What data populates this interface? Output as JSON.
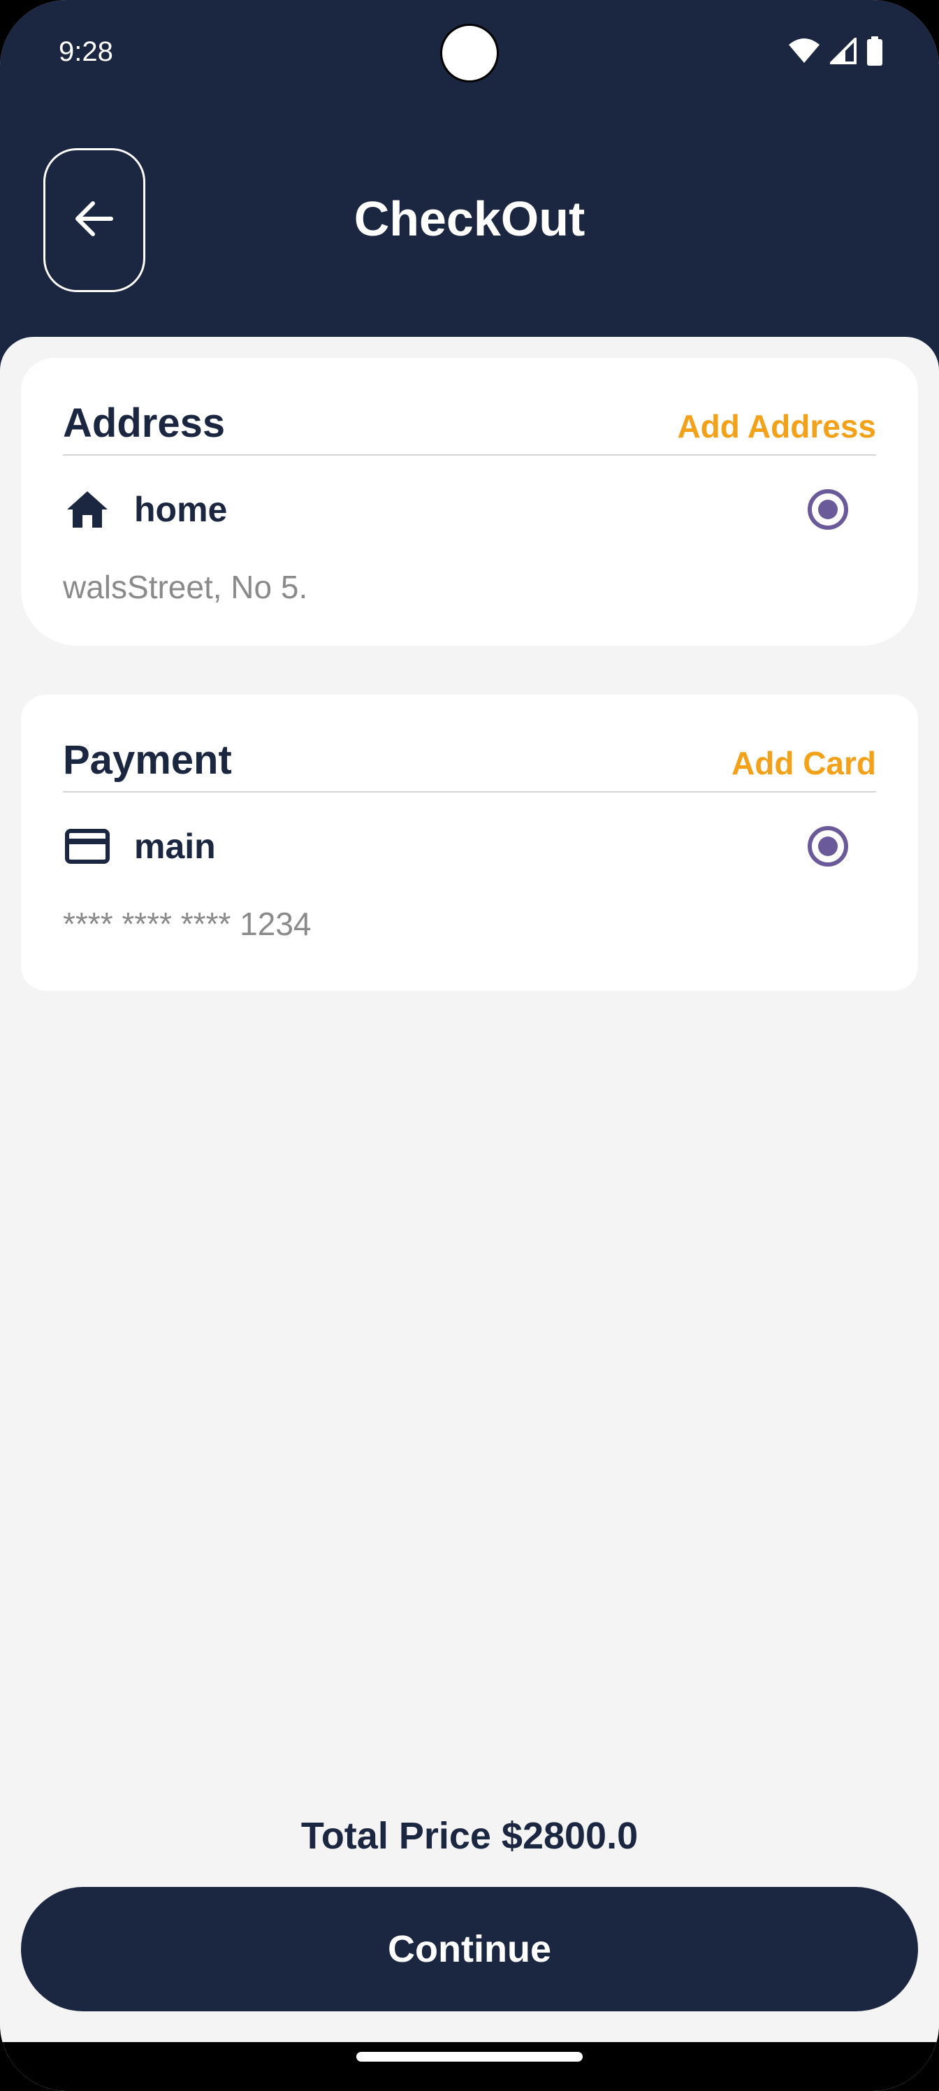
{
  "status_bar": {
    "time": "9:28",
    "icons": [
      "wifi-icon",
      "signal-icon",
      "battery-icon"
    ]
  },
  "header": {
    "title": "CheckOut",
    "back_icon": "arrow-left-icon"
  },
  "address": {
    "title": "Address",
    "action_label": "Add Address",
    "item": {
      "icon": "home-icon",
      "label": "home",
      "detail": "walsStreet, No 5.",
      "selected": true
    }
  },
  "payment": {
    "title": "Payment",
    "action_label": "Add Card",
    "item": {
      "icon": "credit-card-icon",
      "label": "main",
      "detail": "**** **** **** 1234",
      "selected": true
    }
  },
  "summary": {
    "total_label": "Total Price $2800.0"
  },
  "footer": {
    "continue_label": "Continue"
  },
  "colors": {
    "primary": "#1b2740",
    "accent": "#f4a11a",
    "radio": "#6a5a9a",
    "background": "#f4f4f4",
    "muted_text": "#8a8a8a"
  }
}
